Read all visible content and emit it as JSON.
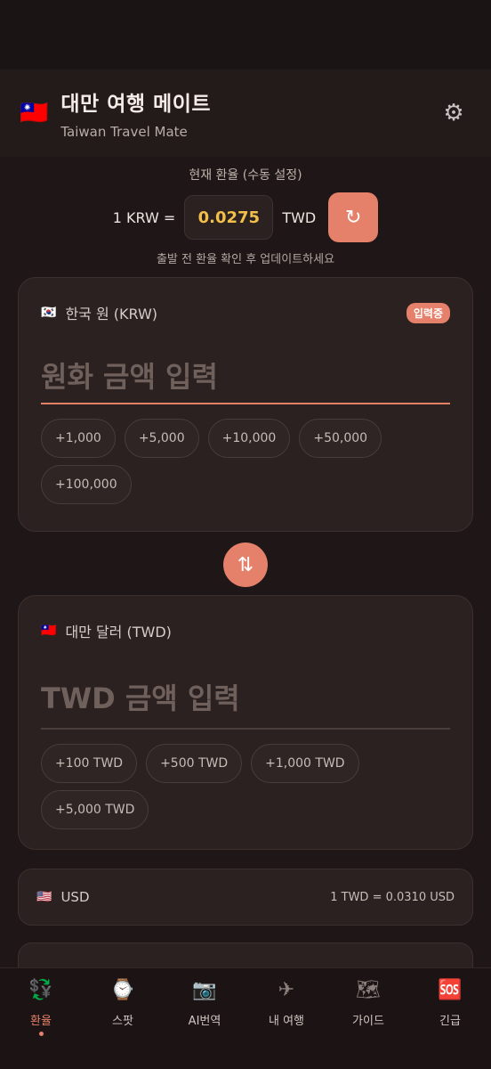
{
  "header": {
    "flag": "🇹🇼",
    "title": "대만 여행 메이트",
    "subtitle": "Taiwan Travel Mate"
  },
  "rate": {
    "title": "현재 환율 (수동 설정)",
    "prefix": "1 KRW =",
    "value": "0.0275",
    "suffix": "TWD",
    "note": "출발 전 환율 확인 후 업데이트하세요"
  },
  "krw_card": {
    "flag": "🇰🇷",
    "label": "한국 원 (KRW)",
    "badge": "입력중",
    "placeholder": "원화 금액 입력",
    "chips": [
      "+1,000",
      "+5,000",
      "+10,000",
      "+50,000",
      "+100,000"
    ]
  },
  "twd_card": {
    "flag": "🇹🇼",
    "label": "대만 달러 (TWD)",
    "placeholder": "TWD 금액 입력",
    "chips": [
      "+100 TWD",
      "+500 TWD",
      "+1,000 TWD",
      "+5,000 TWD"
    ]
  },
  "usd": {
    "flag": "🇺🇸",
    "label": "USD",
    "rate": "1 TWD = 0.0310 USD"
  },
  "tabs": [
    {
      "icon": "💱",
      "label": "환율",
      "active": true
    },
    {
      "icon": "⌚",
      "label": "스팟"
    },
    {
      "icon": "📷",
      "label": "AI번역"
    },
    {
      "icon": "✈",
      "label": "내 여행"
    },
    {
      "icon": "🗺",
      "label": "가이드"
    },
    {
      "icon": "🆘",
      "label": "긴급"
    }
  ],
  "colors": {
    "accent": "#e5806a",
    "rate_value": "#f2c04a",
    "background": "#1f1717"
  }
}
